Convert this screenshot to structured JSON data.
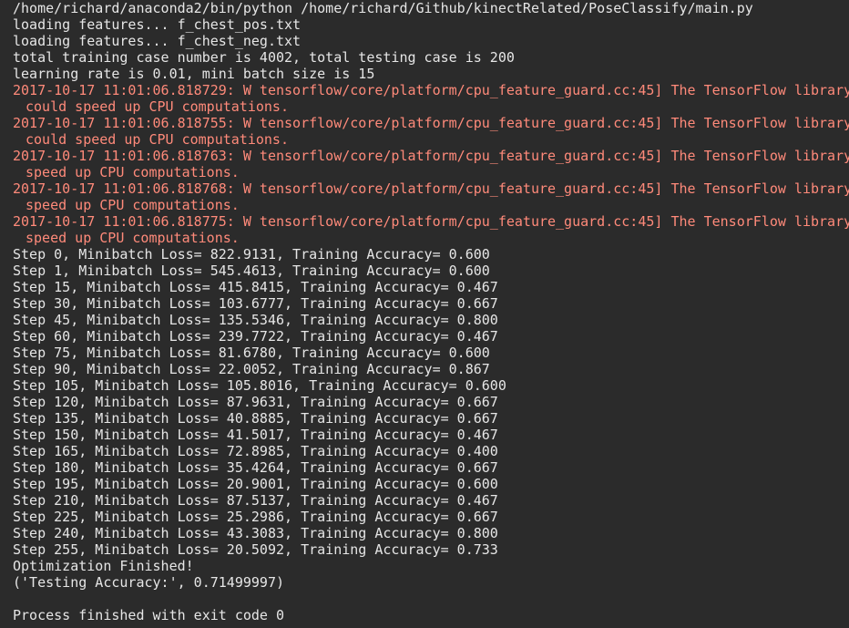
{
  "console": {
    "lines": [
      {
        "text": "/home/richard/anaconda2/bin/python /home/richard/Github/kinectRelated/PoseClassify/main.py",
        "kind": "normal"
      },
      {
        "text": "loading features... f_chest_pos.txt",
        "kind": "normal"
      },
      {
        "text": "loading features... f_chest_neg.txt",
        "kind": "normal"
      },
      {
        "text": "total training case number is 4002, total testing case is 200",
        "kind": "normal"
      },
      {
        "text": "learning rate is 0.01, mini batch size is 15",
        "kind": "normal"
      },
      {
        "text": "2017-10-17 11:01:06.818729: W tensorflow/core/platform/cpu_feature_guard.cc:45] The TensorFlow library",
        "kind": "warn"
      },
      {
        "text": "could speed up CPU computations.",
        "kind": "warn-cont"
      },
      {
        "text": "2017-10-17 11:01:06.818755: W tensorflow/core/platform/cpu_feature_guard.cc:45] The TensorFlow library",
        "kind": "warn"
      },
      {
        "text": "could speed up CPU computations.",
        "kind": "warn-cont"
      },
      {
        "text": "2017-10-17 11:01:06.818763: W tensorflow/core/platform/cpu_feature_guard.cc:45] The TensorFlow library",
        "kind": "warn"
      },
      {
        "text": "speed up CPU computations.",
        "kind": "warn-cont"
      },
      {
        "text": "2017-10-17 11:01:06.818768: W tensorflow/core/platform/cpu_feature_guard.cc:45] The TensorFlow library",
        "kind": "warn"
      },
      {
        "text": "speed up CPU computations.",
        "kind": "warn-cont"
      },
      {
        "text": "2017-10-17 11:01:06.818775: W tensorflow/core/platform/cpu_feature_guard.cc:45] The TensorFlow library",
        "kind": "warn"
      },
      {
        "text": "speed up CPU computations.",
        "kind": "warn-cont"
      },
      {
        "text": "Step 0, Minibatch Loss= 822.9131, Training Accuracy= 0.600",
        "kind": "normal"
      },
      {
        "text": "Step 1, Minibatch Loss= 545.4613, Training Accuracy= 0.600",
        "kind": "normal"
      },
      {
        "text": "Step 15, Minibatch Loss= 415.8415, Training Accuracy= 0.467",
        "kind": "normal"
      },
      {
        "text": "Step 30, Minibatch Loss= 103.6777, Training Accuracy= 0.667",
        "kind": "normal"
      },
      {
        "text": "Step 45, Minibatch Loss= 135.5346, Training Accuracy= 0.800",
        "kind": "normal"
      },
      {
        "text": "Step 60, Minibatch Loss= 239.7722, Training Accuracy= 0.467",
        "kind": "normal"
      },
      {
        "text": "Step 75, Minibatch Loss= 81.6780, Training Accuracy= 0.600",
        "kind": "normal"
      },
      {
        "text": "Step 90, Minibatch Loss= 22.0052, Training Accuracy= 0.867",
        "kind": "normal"
      },
      {
        "text": "Step 105, Minibatch Loss= 105.8016, Training Accuracy= 0.600",
        "kind": "normal"
      },
      {
        "text": "Step 120, Minibatch Loss= 87.9631, Training Accuracy= 0.667",
        "kind": "normal"
      },
      {
        "text": "Step 135, Minibatch Loss= 40.8885, Training Accuracy= 0.667",
        "kind": "normal"
      },
      {
        "text": "Step 150, Minibatch Loss= 41.5017, Training Accuracy= 0.467",
        "kind": "normal"
      },
      {
        "text": "Step 165, Minibatch Loss= 72.8985, Training Accuracy= 0.400",
        "kind": "normal"
      },
      {
        "text": "Step 180, Minibatch Loss= 35.4264, Training Accuracy= 0.667",
        "kind": "normal"
      },
      {
        "text": "Step 195, Minibatch Loss= 20.9001, Training Accuracy= 0.600",
        "kind": "normal"
      },
      {
        "text": "Step 210, Minibatch Loss= 87.5137, Training Accuracy= 0.467",
        "kind": "normal"
      },
      {
        "text": "Step 225, Minibatch Loss= 25.2986, Training Accuracy= 0.667",
        "kind": "normal"
      },
      {
        "text": "Step 240, Minibatch Loss= 43.3083, Training Accuracy= 0.800",
        "kind": "normal"
      },
      {
        "text": "Step 255, Minibatch Loss= 20.5092, Training Accuracy= 0.733",
        "kind": "normal"
      },
      {
        "text": "Optimization Finished!",
        "kind": "normal"
      },
      {
        "text": "('Testing Accuracy:', 0.71499997)",
        "kind": "normal"
      },
      {
        "text": "",
        "kind": "blank"
      },
      {
        "text": "Process finished with exit code 0",
        "kind": "normal"
      }
    ],
    "colors": {
      "background": "#2b2b2b",
      "text": "#e6e6e6",
      "warning": "#ff8a7a"
    }
  }
}
